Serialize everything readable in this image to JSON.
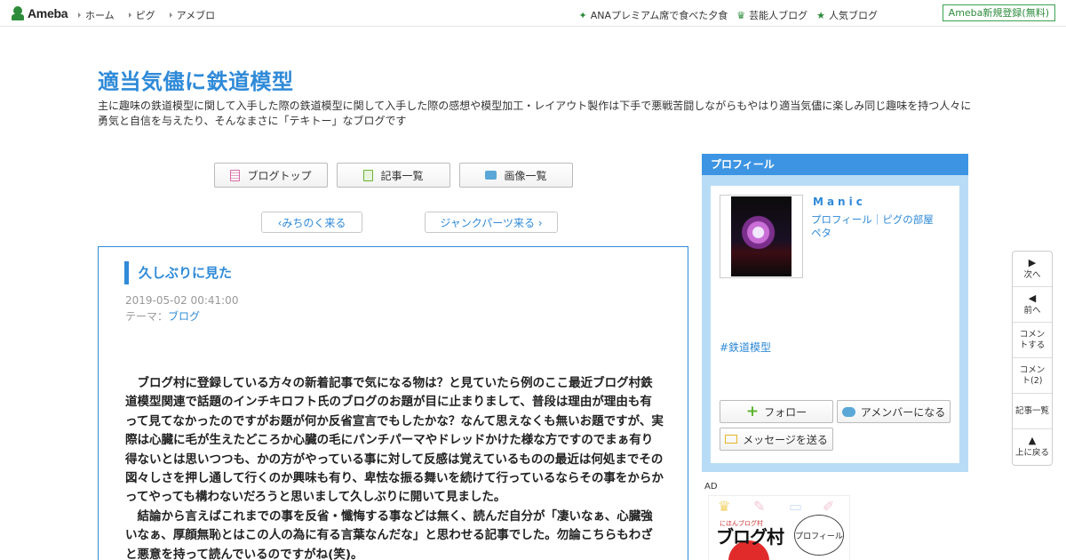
{
  "topbar": {
    "logo": "Ameba",
    "nav": [
      "ホーム",
      "ピグ",
      "アメブロ"
    ],
    "links": [
      {
        "icon": "sparkle-icon",
        "label": "ANAプレミアム席で食べた夕食"
      },
      {
        "icon": "crown-icon",
        "label": "芸能人ブログ"
      },
      {
        "icon": "star-icon",
        "label": "人気ブログ"
      }
    ],
    "register": "Ameba新規登録(無料)"
  },
  "header": {
    "title": "適当気儘に鉄道模型",
    "description": "主に趣味の鉄道模型に関して入手した際の鉄道模型に関して入手した際の感想や模型加工・レイアウト製作は下手で悪戦苦闘しながらもやはり適当気儘に楽しみ同じ趣味を持つ人々に勇気と自信を与えたり、そんなまさに「テキトー」なブログです"
  },
  "mainnav": {
    "blogtop": "ブログトップ",
    "entries": "記事一覧",
    "images": "画像一覧"
  },
  "pager": {
    "prev": "‹みちのく来る",
    "next": "ジャンクパーツ来る ›"
  },
  "article": {
    "title": "久しぶりに見た",
    "date": "2019-05-02 00:41:00",
    "theme_prefix": "テーマ：",
    "theme": "ブログ",
    "paragraphs": [
      "ブログ村に登録している方々の新着記事で気になる物は？と見ていたら例のここ最近ブログ村鉄道模型関連で話題のインチキロフト氏のブログのお題が目に止まりまして、普段は理由が理由も有って見てなかったのですがお題が何か反省宣言でもしたかな？なんて思えなくも無いお題ですが、実際は心臓に毛が生えたどころか心臓の毛にパンチパーマやドレッドかけた様な方ですのでまぁ有り得ないとは思いつつも、かの方がやっている事に対して反感は覚えているものの最近は何処までその図々しさを押し通して行くのか興味も有り、卑怯な振る舞いを続けて行っているならその事をからかってやっても構わないだろうと思いまして久しぶりに開いて見ました。",
      "結論から言えばこれまでの事を反省・懺悔する事などは無く、読んだ自分が「凄いなぁ、心臓強いなぁ、厚顔無恥とはこの人の為に有る言葉なんだな」と思わせる記事でした。勿論こちらもわざと悪意を持って読んでいるのですがね(笑)。"
    ]
  },
  "profile": {
    "heading": "プロフィール",
    "name": "Manic",
    "links": "プロフィール｜ピグの部屋",
    "peta": "ペタ",
    "tag": "#鉄道模型",
    "follow": "フォロー",
    "amember": "アメンバーになる",
    "message": "メッセージを送る"
  },
  "ad": {
    "label": "AD",
    "small": "にほんブログ村",
    "brand": "ブログ村",
    "bubble": "プロフィール"
  },
  "tools": {
    "next": "次へ",
    "prev": "前へ",
    "comment": "コメントする",
    "comment_count": "コメント(2)",
    "entries": "記事一覧",
    "top": "上に戻る"
  }
}
